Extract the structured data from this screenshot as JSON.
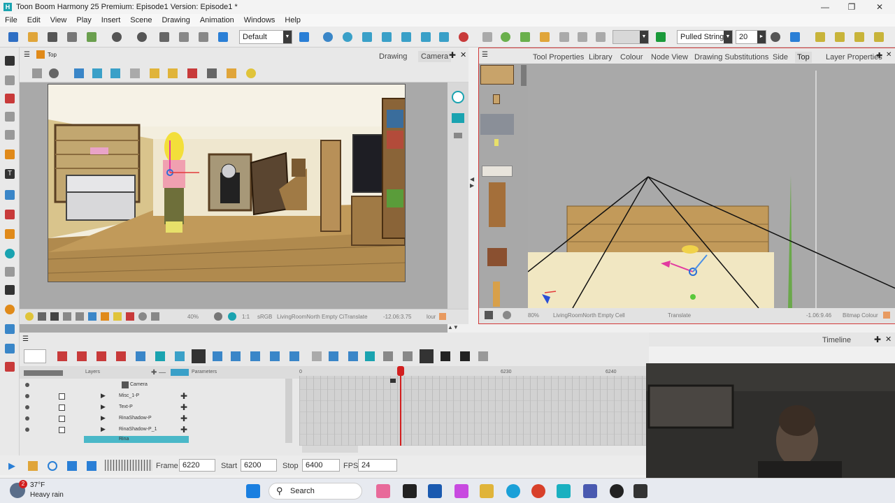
{
  "window": {
    "title": "Toon Boom Harmony 25 Premium: Episode1 Version: Episode1 *",
    "logo_letter": "H"
  },
  "menu": [
    "File",
    "Edit",
    "View",
    "Play",
    "Insert",
    "Scene",
    "Drawing",
    "Animation",
    "Windows",
    "Help"
  ],
  "toolbar": {
    "workspace_value": "Default",
    "deform_value": "Pulled String",
    "size_value": "20"
  },
  "camera_view": {
    "breadcrumb": "Top",
    "tabs": [
      "Drawing",
      "Camera"
    ],
    "zoom": "40%",
    "color_space": "sRGB",
    "status_text": "LivingRoomNorth Empty CiTranslate",
    "coords": "-12.06:3.75",
    "color_label": "lour",
    "ratio": "1:1"
  },
  "right_view": {
    "tabs": [
      "Tool Properties",
      "Library",
      "Colour",
      "Node View",
      "Drawing Substitutions",
      "Side",
      "Top",
      "Layer Properties"
    ],
    "active_tab": "Top",
    "zoom": "80%",
    "status_text": "LivingRoomNorth Empty Cell",
    "mode": "Translate",
    "coords": "-1.06:9.46",
    "color_label": "Bitmap Colour"
  },
  "timeline": {
    "label": "Timeline",
    "header_layers": "Layers",
    "header_params": "Parameters",
    "frame_marks": [
      "0",
      "6230",
      "6240"
    ],
    "layers": [
      {
        "name": "Camera"
      },
      {
        "name": "Misc_1-P"
      },
      {
        "name": "Text-P"
      },
      {
        "name": "RinaShadow-P"
      },
      {
        "name": "RinaShadow-P_1"
      },
      {
        "name": "Rina"
      }
    ]
  },
  "playback": {
    "frame_label": "Frame",
    "frame_value": "6220",
    "start_label": "Start",
    "start_value": "6200",
    "stop_label": "Stop",
    "stop_value": "6400",
    "fps_label": "FPS",
    "fps_value": "24"
  },
  "taskbar": {
    "weather_temp": "37°F",
    "weather_desc": "Heavy rain",
    "notif_count": "2",
    "search_label": "Search"
  }
}
